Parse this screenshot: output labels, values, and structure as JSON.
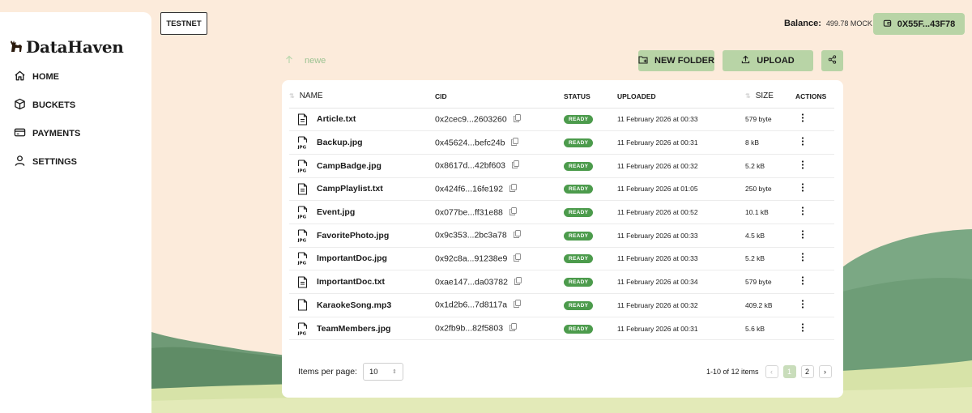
{
  "brand": {
    "name": "DataHaven"
  },
  "sidebar": {
    "items": [
      {
        "label": "HOME",
        "icon": "home-icon"
      },
      {
        "label": "BUCKETS",
        "icon": "cube-icon"
      },
      {
        "label": "PAYMENTS",
        "icon": "card-icon"
      },
      {
        "label": "SETTINGS",
        "icon": "user-icon"
      }
    ]
  },
  "header": {
    "network": "TESTNET",
    "balance_label": "Balance:",
    "balance_value": "499.78 MOCK",
    "wallet_address": "0X55F...43F78"
  },
  "toolbar": {
    "folder_name": "newe",
    "new_folder_label": "NEW FOLDER",
    "upload_label": "UPLOAD"
  },
  "table": {
    "columns": {
      "name": "NAME",
      "cid": "CID",
      "status": "STATUS",
      "uploaded": "UPLOADED",
      "size": "SIZE",
      "actions": "ACTIONS"
    },
    "rows": [
      {
        "name": "Article.txt",
        "type": "txt",
        "cid": "0x2cec9...2603260",
        "status": "READY",
        "uploaded": "11 February 2026 at 00:33",
        "size": "579 byte"
      },
      {
        "name": "Backup.jpg",
        "type": "jpg",
        "cid": "0x45624...befc24b",
        "status": "READY",
        "uploaded": "11 February 2026 at 00:31",
        "size": "8 kB"
      },
      {
        "name": "CampBadge.jpg",
        "type": "jpg",
        "cid": "0x8617d...42bf603",
        "status": "READY",
        "uploaded": "11 February 2026 at 00:32",
        "size": "5.2 kB"
      },
      {
        "name": "CampPlaylist.txt",
        "type": "txt",
        "cid": "0x424f6...16fe192",
        "status": "READY",
        "uploaded": "11 February 2026 at 01:05",
        "size": "250 byte"
      },
      {
        "name": "Event.jpg",
        "type": "jpg",
        "cid": "0x077be...ff31e88",
        "status": "READY",
        "uploaded": "11 February 2026 at 00:52",
        "size": "10.1 kB"
      },
      {
        "name": "FavoritePhoto.jpg",
        "type": "jpg",
        "cid": "0x9c353...2bc3a78",
        "status": "READY",
        "uploaded": "11 February 2026 at 00:33",
        "size": "4.5 kB"
      },
      {
        "name": "ImportantDoc.jpg",
        "type": "jpg",
        "cid": "0x92c8a...91238e9",
        "status": "READY",
        "uploaded": "11 February 2026 at 00:33",
        "size": "5.2 kB"
      },
      {
        "name": "ImportantDoc.txt",
        "type": "txt",
        "cid": "0xae147...da03782",
        "status": "READY",
        "uploaded": "11 February 2026 at 00:34",
        "size": "579 byte"
      },
      {
        "name": "KaraokeSong.mp3",
        "type": "file",
        "cid": "0x1d2b6...7d8117a",
        "status": "READY",
        "uploaded": "11 February 2026 at 00:32",
        "size": "409.2 kB"
      },
      {
        "name": "TeamMembers.jpg",
        "type": "jpg",
        "cid": "0x2fb9b...82f5803",
        "status": "READY",
        "uploaded": "11 February 2026 at 00:31",
        "size": "5.6 kB"
      }
    ]
  },
  "pagination": {
    "items_per_page_label": "Items per page:",
    "items_per_page_value": "10",
    "range_text": "1-10 of 12 items",
    "pages": [
      "1",
      "2"
    ],
    "current_page": "1"
  },
  "colors": {
    "accent_green": "#b8d4a6",
    "ready_badge": "#4c9b4c",
    "background": "#fcebdb"
  }
}
